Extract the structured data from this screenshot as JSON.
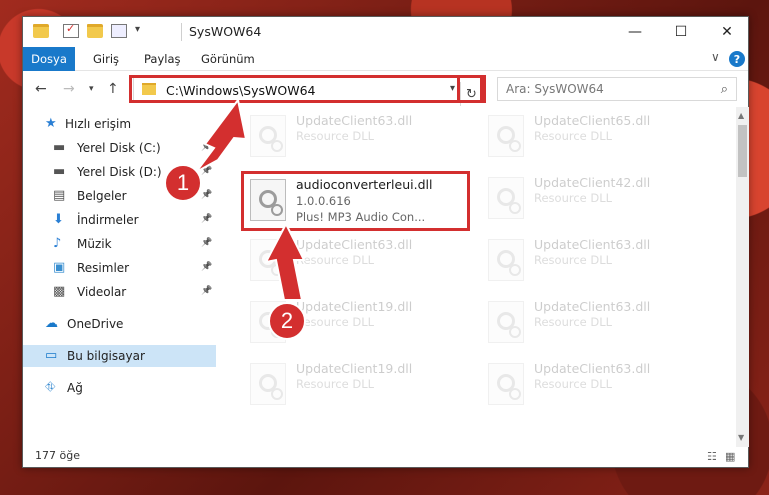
{
  "titlebar": {
    "title": "SysWOW64",
    "minimize": "—",
    "maximize": "☐",
    "close": "✕",
    "qat_dropdown": "▾"
  },
  "ribbon": {
    "tabs": [
      "Dosya",
      "Giriş",
      "Paylaş",
      "Görünüm"
    ],
    "expand": "∨",
    "help": "?"
  },
  "address": {
    "path": "C:\\Windows\\SysWOW64",
    "search_placeholder": "Ara: SysWOW64"
  },
  "sidebar": {
    "items": [
      {
        "label": "Hızlı erişim",
        "icon": "star-icon",
        "pinned": false
      },
      {
        "label": "Yerel Disk (C:)",
        "icon": "drive-icon",
        "pinned": true
      },
      {
        "label": "Yerel Disk (D:)",
        "icon": "drive-icon",
        "pinned": true
      },
      {
        "label": "Belgeler",
        "icon": "documents-icon",
        "pinned": true
      },
      {
        "label": "İndirmeler",
        "icon": "downloads-icon",
        "pinned": true
      },
      {
        "label": "Müzik",
        "icon": "music-icon",
        "pinned": true
      },
      {
        "label": "Resimler",
        "icon": "pictures-icon",
        "pinned": true
      },
      {
        "label": "Videolar",
        "icon": "videos-icon",
        "pinned": true
      },
      {
        "label": "OneDrive",
        "icon": "cloud-icon",
        "pinned": false
      },
      {
        "label": "Bu bilgisayar",
        "icon": "computer-icon",
        "pinned": false,
        "selected": true
      },
      {
        "label": "Ağ",
        "icon": "network-icon",
        "pinned": false
      }
    ]
  },
  "files": {
    "highlighted": {
      "name": "audioconverterleui.dll",
      "version": "1.0.0.616",
      "description": "Plus! MP3 Audio Con..."
    },
    "faded": [
      {
        "name": "UpdateClient63.dll",
        "type": "Resource DLL"
      },
      {
        "name": "UpdateClient65.dll",
        "type": "Resource DLL"
      },
      {
        "name": "UpdateClient42.dll",
        "type": "Resource DLL"
      },
      {
        "name": "UpdateClient63.dll",
        "type": "Resource DLL"
      },
      {
        "name": "UpdateClient63.dll",
        "type": "Resource DLL"
      },
      {
        "name": "UpdateClient19.dll",
        "type": "Resource DLL"
      },
      {
        "name": "UpdateClient63.dll",
        "type": "Resource DLL"
      },
      {
        "name": "UpdateClient19.dll",
        "type": "Resource DLL"
      },
      {
        "name": "UpdateClient63.dll",
        "type": "Resource DLL"
      }
    ]
  },
  "status": {
    "count": "177 öğe"
  },
  "annotations": {
    "step1": "1",
    "step2": "2"
  },
  "colors": {
    "accent": "#1979ca",
    "highlight_box": "#d32f2f",
    "selected_bg": "#cce4f7"
  }
}
